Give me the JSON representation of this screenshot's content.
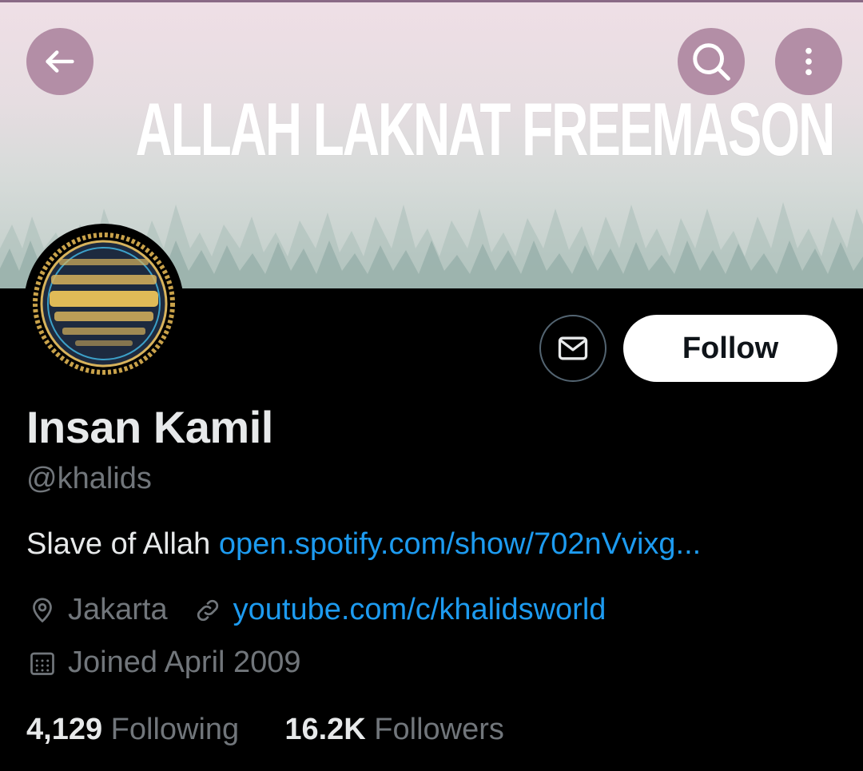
{
  "banner": {
    "text": "ALLAH LAKNAT FREEMASON"
  },
  "header_buttons": {
    "back_icon": "arrow-left-icon",
    "search_icon": "search-icon",
    "more_icon": "more-vertical-icon"
  },
  "profile": {
    "name": "Insan Kamil",
    "handle": "@khalids",
    "bio_text": "Slave of Allah",
    "bio_link": "open.spotify.com/show/702nVvixg...",
    "location": "Jakarta",
    "website": "youtube.com/c/khalidsworld",
    "joined": "Joined April 2009"
  },
  "actions": {
    "message_icon": "mail-icon",
    "follow_label": "Follow"
  },
  "stats": {
    "following_count": "4,129",
    "following_label": "Following",
    "followers_count": "16.2K",
    "followers_label": "Followers"
  },
  "colors": {
    "accent_link": "#1d9bf0",
    "muted_text": "#71767b",
    "button_overlay": "#b38ea6",
    "background": "#000000"
  }
}
